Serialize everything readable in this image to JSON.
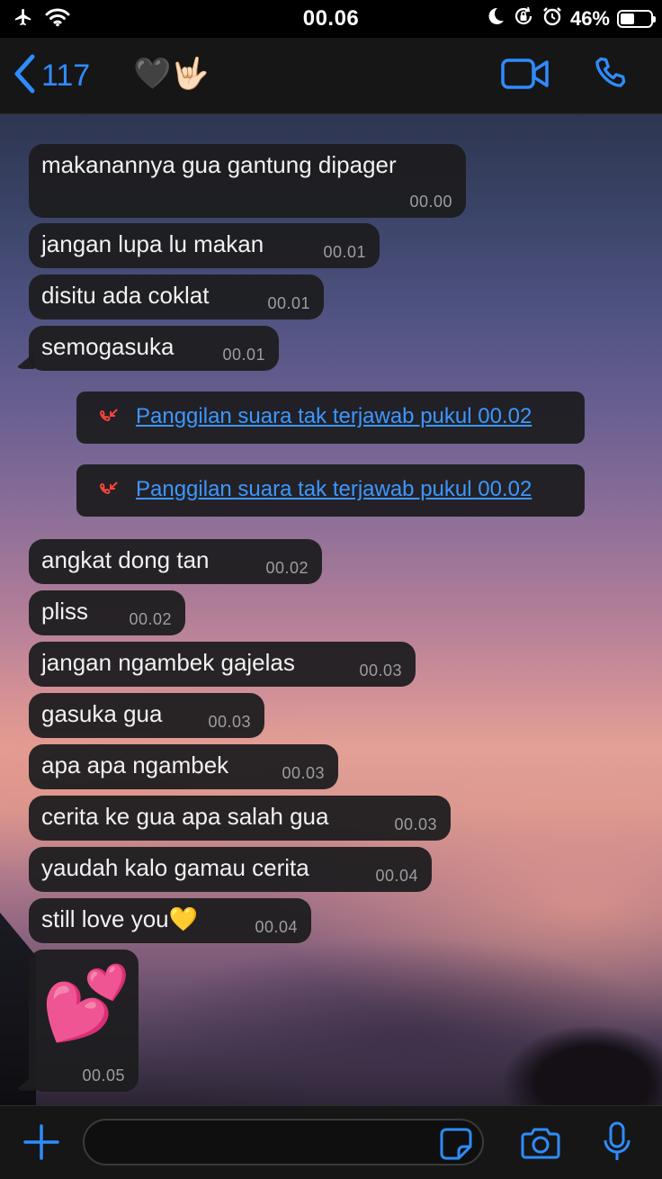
{
  "status_bar": {
    "time": "00.06",
    "battery_text": "46%",
    "battery_level": 0.46
  },
  "header": {
    "back_count": "117",
    "contact_name": "🖤🤟🏻"
  },
  "messages": [
    {
      "text": "makanannya gua gantung dipager",
      "time": "00.00"
    },
    {
      "text": "jangan lupa lu makan",
      "time": "00.01"
    },
    {
      "text": "disitu ada coklat",
      "time": "00.01"
    },
    {
      "text": "semogasuka",
      "time": "00.01"
    },
    {
      "text": "angkat dong tan",
      "time": "00.02"
    },
    {
      "text": "pliss",
      "time": "00.02"
    },
    {
      "text": "jangan ngambek gajelas",
      "time": "00.03"
    },
    {
      "text": "gasuka gua",
      "time": "00.03"
    },
    {
      "text": "apa apa ngambek",
      "time": "00.03"
    },
    {
      "text": "cerita ke gua apa salah gua",
      "time": "00.03"
    },
    {
      "text": "yaudah kalo gamau cerita",
      "time": "00.04"
    },
    {
      "text": "still love you💛",
      "time": "00.04"
    },
    {
      "text": "💕",
      "time": "00.05"
    }
  ],
  "missed_calls": [
    {
      "text": "Panggilan suara tak terjawab pukul 00.02"
    },
    {
      "text": "Panggilan suara tak terjawab pukul 00.02"
    }
  ],
  "input": {
    "value": "",
    "placeholder": ""
  },
  "colors": {
    "accent": "#2f8cff",
    "bubble": "#1d1d1f",
    "missed_call": "#ff453a"
  }
}
